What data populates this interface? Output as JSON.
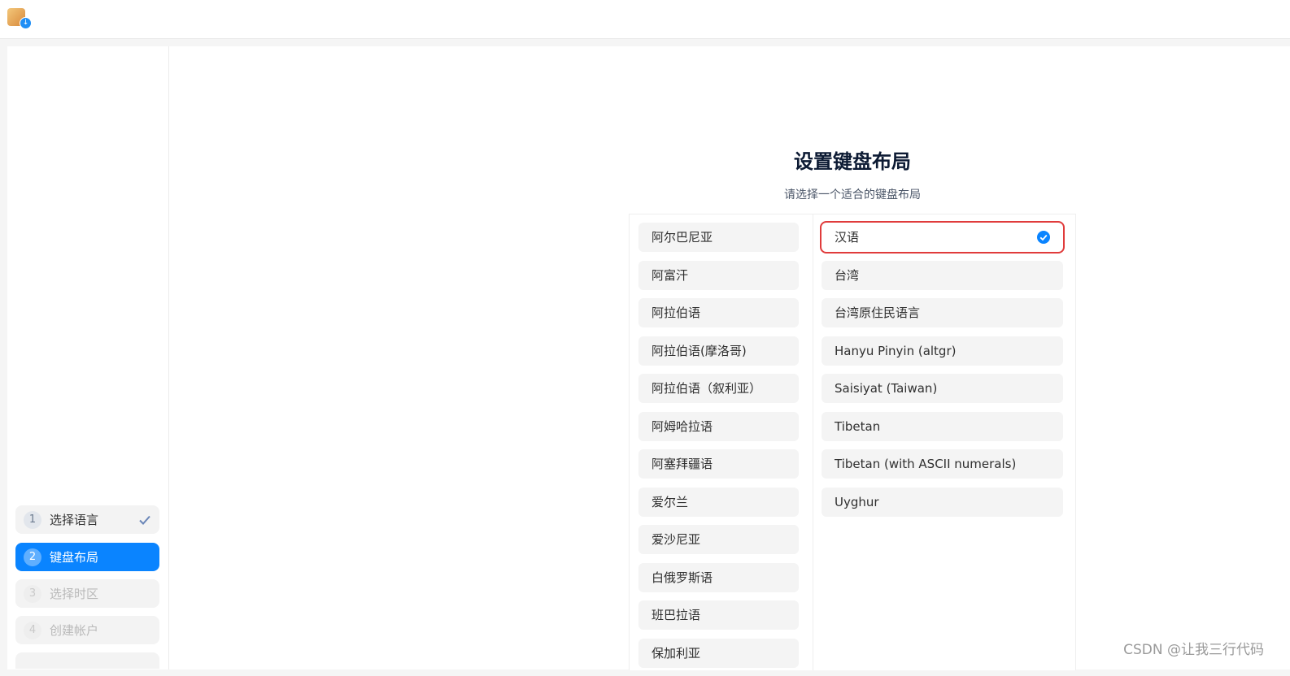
{
  "sidebar": {
    "steps": [
      {
        "num": "1",
        "label": "选择语言",
        "state": "done"
      },
      {
        "num": "2",
        "label": "键盘布局",
        "state": "active"
      },
      {
        "num": "3",
        "label": "选择时区",
        "state": "disabled"
      },
      {
        "num": "4",
        "label": "创建帐户",
        "state": "disabled"
      }
    ]
  },
  "main": {
    "title": "设置键盘布局",
    "subtitle": "请选择一个适合的键盘布局",
    "layouts": [
      "阿尔巴尼亚",
      "阿富汗",
      "阿拉伯语",
      "阿拉伯语(摩洛哥)",
      "阿拉伯语（叙利亚）",
      "阿姆哈拉语",
      "阿塞拜疆语",
      "爱尔兰",
      "爱沙尼亚",
      "白俄罗斯语",
      "班巴拉语",
      "保加利亚"
    ],
    "variants": [
      "汉语",
      "台湾",
      "台湾原住民语言",
      "Hanyu Pinyin (altgr)",
      "Saisiyat (Taiwan)",
      "Tibetan",
      "Tibetan (with ASCII numerals)",
      "Uyghur"
    ],
    "selected_variant": "汉语"
  },
  "watermark": "CSDN @让我三行代码",
  "colors": {
    "accent": "#0a84ff",
    "highlight": "#e03b3b"
  },
  "icons": {
    "app": "package-download-icon",
    "done": "check-icon",
    "selected": "check-circle-icon"
  }
}
